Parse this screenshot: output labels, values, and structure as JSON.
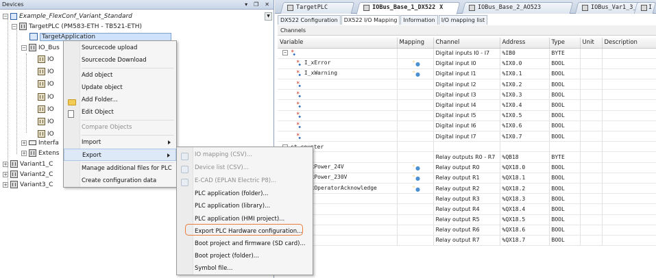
{
  "devices": {
    "title": "Devices",
    "header_buttons": [
      "▾",
      "❐",
      "✕"
    ],
    "tree": [
      {
        "label": "Example_FlexConf_Variant_Standard",
        "italic": true
      },
      {
        "label": "TargetPLC (PM583-ETH - TB521-ETH)"
      },
      {
        "label": "TargetApplication"
      },
      {
        "label": "IO_Bus"
      },
      {
        "label": "IO"
      },
      {
        "label": "IO"
      },
      {
        "label": "IO"
      },
      {
        "label": "IO"
      },
      {
        "label": "IO"
      },
      {
        "label": "IO"
      },
      {
        "label": "IO"
      },
      {
        "label": "Interfa"
      },
      {
        "label": "Extens"
      },
      {
        "label": "Variant1_C"
      },
      {
        "label": "Variant2_C"
      },
      {
        "label": "Variant3_C"
      }
    ]
  },
  "context_menu": {
    "items": [
      "Sourcecode upload",
      "Sourcecode Download",
      "Add object",
      "Update object",
      "Add Folder...",
      "Edit Object",
      "Compare Objects",
      "Import",
      "Export",
      "Manage additional files for PLC",
      "Create configuration data"
    ]
  },
  "export_menu": {
    "items": [
      "IO mapping (CSV)...",
      "Device list (CSV)...",
      "E-CAD (EPLAN Electric P8)...",
      "PLC application (folder)...",
      "PLC application (library)...",
      "PLC application (HMI project)...",
      "Export PLC Hardware configuration...",
      "Boot project and firmware (SD card)...",
      "Boot project (folder)...",
      "Symbol file..."
    ]
  },
  "editor": {
    "doc_tabs": [
      "TargetPLC",
      "IOBus_Base_1_DX522",
      "IOBus_Base_2_AO523",
      "IOBus_Var1_3_AI523",
      "I"
    ],
    "active_close": "X",
    "sub_tabs": [
      "DX522 Configuration",
      "DX522 I/O Mapping",
      "Information",
      "I/O mapping list"
    ],
    "section": "Channels",
    "columns": [
      "Variable",
      "Mapping",
      "Channel",
      "Address",
      "Type",
      "Unit",
      "Description"
    ],
    "rows": [
      {
        "variable": "",
        "mapping": false,
        "channel": "Digital inputs I0 - I7",
        "address": "%IB0",
        "type": "BYTE"
      },
      {
        "variable": "I_xError",
        "mapping": true,
        "channel": "Digital input I0",
        "address": "%IX0.0",
        "type": "BOOL"
      },
      {
        "variable": "I_xWarning",
        "mapping": true,
        "channel": "Digital input I1",
        "address": "%IX0.1",
        "type": "BOOL"
      },
      {
        "variable": "",
        "mapping": false,
        "channel": "Digital input I2",
        "address": "%IX0.2",
        "type": "BOOL"
      },
      {
        "variable": "",
        "mapping": false,
        "channel": "Digital input I3",
        "address": "%IX0.3",
        "type": "BOOL"
      },
      {
        "variable": "",
        "mapping": false,
        "channel": "Digital input I4",
        "address": "%IX0.4",
        "type": "BOOL"
      },
      {
        "variable": "",
        "mapping": false,
        "channel": "Digital input I5",
        "address": "%IX0.5",
        "type": "BOOL"
      },
      {
        "variable": "",
        "mapping": false,
        "channel": "Digital input I6",
        "address": "%IX0.6",
        "type": "BOOL"
      },
      {
        "variable": "",
        "mapping": false,
        "channel": "Digital input I7",
        "address": "%IX0.7",
        "type": "BOOL"
      },
      {
        "variable": "st counter",
        "mapping": false,
        "channel": "",
        "address": "",
        "type": ""
      },
      {
        "variable": "",
        "mapping": false,
        "channel": "Relay outputs R0 - R7",
        "address": "%QB18",
        "type": "BYTE"
      },
      {
        "variable": "O_xPower_24V",
        "mapping": true,
        "channel": "Relay output R0",
        "address": "%QX18.0",
        "type": "BOOL"
      },
      {
        "variable": "O_xPower_230V",
        "mapping": true,
        "channel": "Relay output R1",
        "address": "%QX18.1",
        "type": "BOOL"
      },
      {
        "variable": "O_xOperatorAcknowledge",
        "mapping": true,
        "channel": "Relay output R2",
        "address": "%QX18.2",
        "type": "BOOL"
      },
      {
        "variable": "",
        "mapping": false,
        "channel": "Relay output R3",
        "address": "%QX18.3",
        "type": "BOOL"
      },
      {
        "variable": "",
        "mapping": false,
        "channel": "Relay output R4",
        "address": "%QX18.4",
        "type": "BOOL"
      },
      {
        "variable": "",
        "mapping": false,
        "channel": "Relay output R5",
        "address": "%QX18.5",
        "type": "BOOL"
      },
      {
        "variable": "",
        "mapping": false,
        "channel": "Relay output R6",
        "address": "%QX18.6",
        "type": "BOOL"
      },
      {
        "variable": "",
        "mapping": false,
        "channel": "Relay output R7",
        "address": "%QX18.7",
        "type": "BOOL"
      }
    ]
  },
  "colors": {
    "highlight_outline": "#e87c38",
    "selection": "#cfe2fb",
    "pane_header": "#c9d6e8"
  }
}
